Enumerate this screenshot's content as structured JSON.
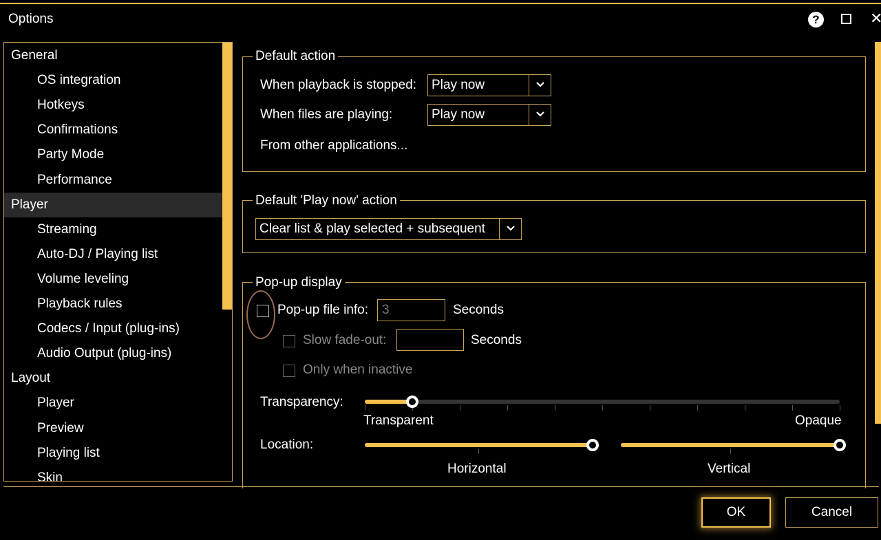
{
  "window": {
    "title": "Options"
  },
  "tree": {
    "items": [
      {
        "label": "General",
        "level": 0
      },
      {
        "label": "OS integration",
        "level": 1
      },
      {
        "label": "Hotkeys",
        "level": 1
      },
      {
        "label": "Confirmations",
        "level": 1
      },
      {
        "label": "Party Mode",
        "level": 1
      },
      {
        "label": "Performance",
        "level": 1
      },
      {
        "label": "Player",
        "level": 0,
        "selected": true
      },
      {
        "label": "Streaming",
        "level": 1
      },
      {
        "label": "Auto-DJ / Playing list",
        "level": 1
      },
      {
        "label": "Volume leveling",
        "level": 1
      },
      {
        "label": "Playback rules",
        "level": 1
      },
      {
        "label": "Codecs / Input (plug-ins)",
        "level": 1
      },
      {
        "label": "Audio Output (plug-ins)",
        "level": 1
      },
      {
        "label": "Layout",
        "level": 0
      },
      {
        "label": "Player",
        "level": 1
      },
      {
        "label": "Preview",
        "level": 1
      },
      {
        "label": "Playing list",
        "level": 1
      },
      {
        "label": "Skin",
        "level": 1
      }
    ]
  },
  "default_action": {
    "legend": "Default action",
    "stopped_label": "When playback is stopped:",
    "stopped_value": "Play now",
    "playing_label": "When files are playing:",
    "playing_value": "Play now",
    "other_apps_link": "From other applications..."
  },
  "play_now_action": {
    "legend": "Default 'Play now' action",
    "value": "Clear list & play selected + subsequent"
  },
  "popup": {
    "legend": "Pop-up display",
    "file_info_label": "Pop-up file info:",
    "file_info_checked": false,
    "seconds_value": "3",
    "seconds_unit": "Seconds",
    "fade_label": "Slow fade-out:",
    "fade_value": "",
    "fade_unit": "Seconds",
    "inactive_label": "Only when inactive",
    "transparency_label": "Transparency:",
    "transparency_min": "Transparent",
    "transparency_max": "Opaque",
    "transparency_level": 0.1,
    "location_label": "Location:",
    "horizontal_label": "Horizontal",
    "horizontal_level": 1.0,
    "vertical_label": "Vertical",
    "vertical_level": 1.0
  },
  "buttons": {
    "ok": "OK",
    "cancel": "Cancel"
  },
  "colors": {
    "accent": "#f5c04d",
    "border": "#c9a35a",
    "background": "#000000"
  }
}
